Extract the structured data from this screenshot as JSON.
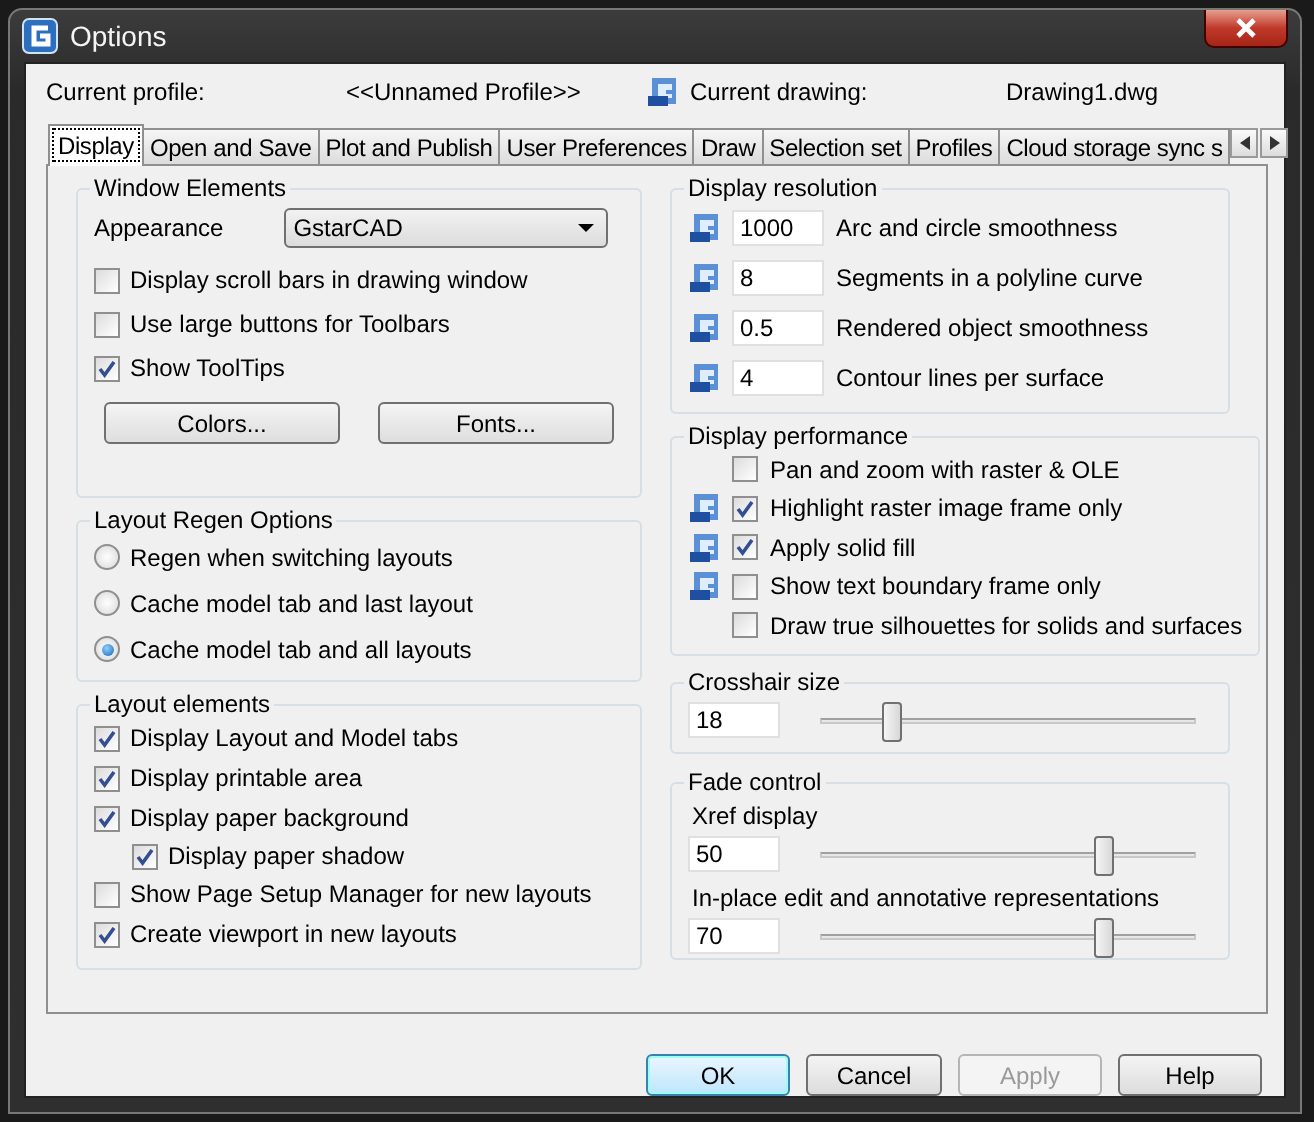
{
  "window": {
    "title": "Options"
  },
  "header": {
    "profile_label": "Current profile:",
    "profile": "<<Unnamed Profile>>",
    "drawing_label": "Current drawing:",
    "drawing": "Drawing1.dwg"
  },
  "tabs": [
    {
      "label": "Display",
      "selected": true
    },
    {
      "label": "Open and Save",
      "selected": false
    },
    {
      "label": "Plot and Publish",
      "selected": false
    },
    {
      "label": "User Preferences",
      "selected": false
    },
    {
      "label": "Draw",
      "selected": false
    },
    {
      "label": "Selection set",
      "selected": false
    },
    {
      "label": "Profiles",
      "selected": false
    },
    {
      "label": "Cloud storage sync s",
      "selected": false
    }
  ],
  "window_elements": {
    "title": "Window Elements",
    "appearance_label": "Appearance",
    "appearance": "GstarCAD",
    "checkboxes": [
      {
        "label": "Display scroll bars in drawing window",
        "checked": false
      },
      {
        "label": "Use large buttons for Toolbars",
        "checked": false
      },
      {
        "label": "Show ToolTips",
        "checked": true
      }
    ],
    "buttons": [
      "Colors...",
      "Fonts..."
    ]
  },
  "layout_regen": {
    "title": "Layout Regen Options",
    "options": [
      {
        "label": "Regen when switching layouts",
        "selected": false
      },
      {
        "label": "Cache model tab and last layout",
        "selected": false
      },
      {
        "label": "Cache model tab and all layouts",
        "selected": true
      }
    ]
  },
  "layout_elements": {
    "title": "Layout elements",
    "items": [
      {
        "label": "Display Layout and Model tabs",
        "checked": true
      },
      {
        "label": "Display printable area",
        "checked": true
      },
      {
        "label": "Display paper background",
        "checked": true,
        "children": [
          {
            "label": "Display paper shadow",
            "checked": true
          }
        ]
      },
      {
        "label": "Show Page Setup Manager for new layouts",
        "checked": false
      },
      {
        "label": "Create viewport in new layouts",
        "checked": true
      }
    ]
  },
  "display_resolution": {
    "title": "Display resolution",
    "rows": [
      {
        "value": "1000",
        "label": "Arc and circle smoothness"
      },
      {
        "value": "8",
        "label": "Segments in a polyline curve"
      },
      {
        "value": "0.5",
        "label": "Rendered object smoothness"
      },
      {
        "value": "4",
        "label": "Contour lines per surface"
      }
    ]
  },
  "display_performance": {
    "title": "Display performance",
    "items": [
      {
        "label": "Pan and zoom with raster & OLE",
        "checked": false,
        "drawing_icon": false
      },
      {
        "label": "Highlight raster image frame only",
        "checked": true,
        "drawing_icon": true
      },
      {
        "label": "Apply solid fill",
        "checked": true,
        "drawing_icon": true
      },
      {
        "label": "Show text boundary frame only",
        "checked": false,
        "drawing_icon": true
      },
      {
        "label": "Draw true silhouettes for solids and surfaces",
        "checked": false,
        "drawing_icon": false
      }
    ]
  },
  "crosshair": {
    "title": "Crosshair size",
    "value": "18",
    "level": 0.19
  },
  "fade": {
    "title": "Fade control",
    "rows": [
      {
        "label": "Xref display",
        "value": "50",
        "level": 0.76
      },
      {
        "label": "In-place edit and annotative representations",
        "value": "70",
        "level": 0.76
      }
    ]
  },
  "buttons": [
    {
      "label": "OK",
      "default": true,
      "disabled": false
    },
    {
      "label": "Cancel",
      "default": false,
      "disabled": false
    },
    {
      "label": "Apply",
      "default": false,
      "disabled": true
    },
    {
      "label": "Help",
      "default": false,
      "disabled": false
    }
  ]
}
